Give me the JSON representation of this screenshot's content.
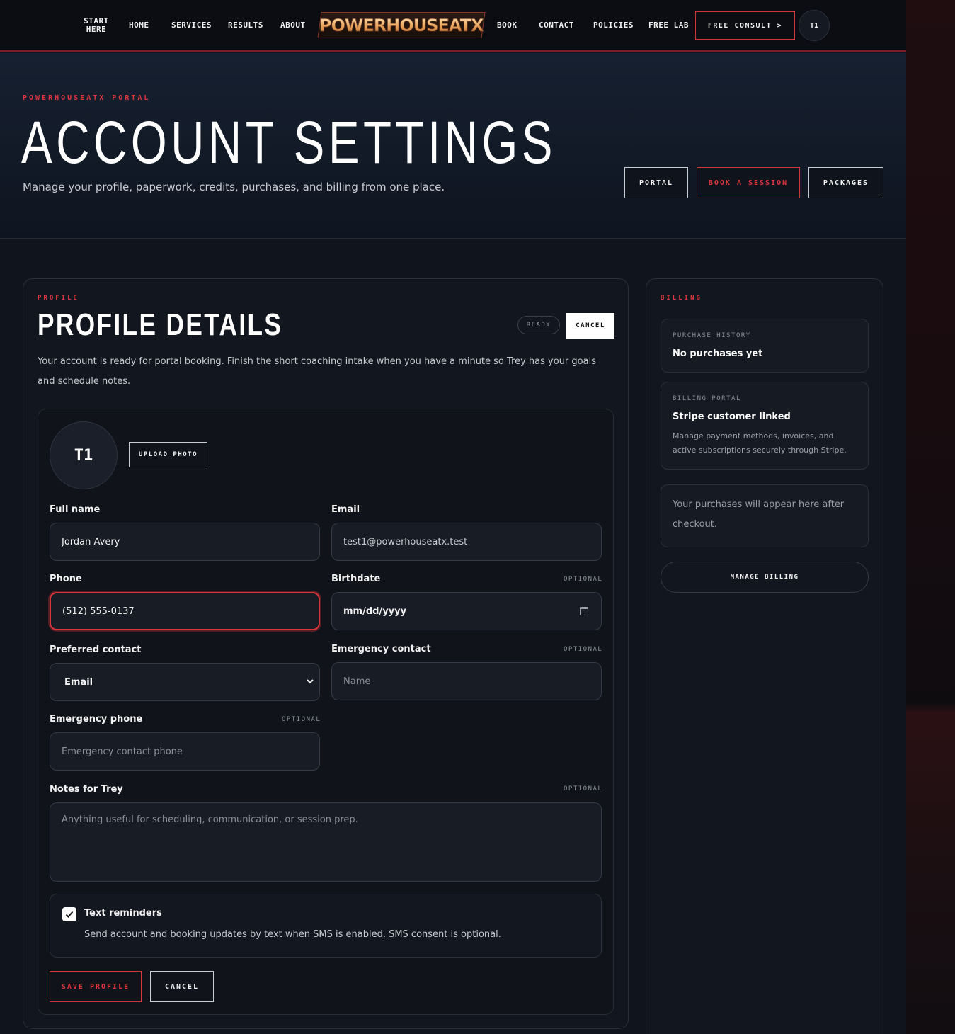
{
  "nav": {
    "start_here": "START HERE",
    "home": "HOME",
    "services": "SERVICES",
    "results": "RESULTS",
    "about": "ABOUT",
    "logo": "POWERHOUSEATX",
    "book": "BOOK",
    "contact": "CONTACT",
    "policies": "POLICIES",
    "free_lab": "FREE LAB",
    "free_consult": "FREE CONSULT  >",
    "avatar": "T1"
  },
  "hero": {
    "eyebrow": "POWERHOUSEATX PORTAL",
    "title": "ACCOUNT SETTINGS",
    "subtitle": "Manage your profile, paperwork, credits, purchases, and billing from one place.",
    "buttons": {
      "portal": "PORTAL",
      "book_session": "BOOK A SESSION",
      "packages": "PACKAGES"
    }
  },
  "profile": {
    "eyebrow": "PROFILE",
    "title": "PROFILE DETAILS",
    "status": "READY",
    "cancel_top": "CANCEL",
    "intro": "Your account is ready for portal booking. Finish the short coaching intake when you have a minute so Trey has your goals and schedule notes.",
    "avatar": "T1",
    "upload_photo": "UPLOAD PHOTO",
    "fields": {
      "full_name": {
        "label": "Full name",
        "value": "Jordan Avery"
      },
      "email": {
        "label": "Email",
        "value": "test1@powerhouseatx.test"
      },
      "phone": {
        "label": "Phone",
        "value": "(512) 555-0137"
      },
      "birthdate": {
        "label": "Birthdate",
        "optional": "OPTIONAL",
        "placeholder": "mm/dd/yyyy"
      },
      "preferred_contact": {
        "label": "Preferred contact",
        "value": "Email"
      },
      "emergency_contact": {
        "label": "Emergency contact",
        "optional": "OPTIONAL",
        "placeholder": "Name"
      },
      "emergency_phone": {
        "label": "Emergency phone",
        "optional": "OPTIONAL",
        "placeholder": "Emergency contact phone"
      },
      "notes": {
        "label": "Notes for Trey",
        "optional": "OPTIONAL",
        "placeholder": "Anything useful for scheduling, communication, or session prep."
      }
    },
    "reminders": {
      "title": "Text reminders",
      "description": "Send account and booking updates by text when SMS is enabled. SMS consent is optional.",
      "checked": true
    },
    "save": "SAVE PROFILE",
    "cancel": "CANCEL"
  },
  "billing": {
    "eyebrow": "BILLING",
    "history": {
      "eyebrow": "PURCHASE HISTORY",
      "title": "No purchases yet"
    },
    "portal": {
      "eyebrow": "BILLING PORTAL",
      "title": "Stripe customer linked",
      "description": "Manage payment methods, invoices, and active subscriptions securely through Stripe."
    },
    "empty_note": "Your purchases will appear here after checkout.",
    "manage": "MANAGE BILLING"
  },
  "colors": {
    "accent": "#d4343c",
    "background": "#10141c"
  }
}
